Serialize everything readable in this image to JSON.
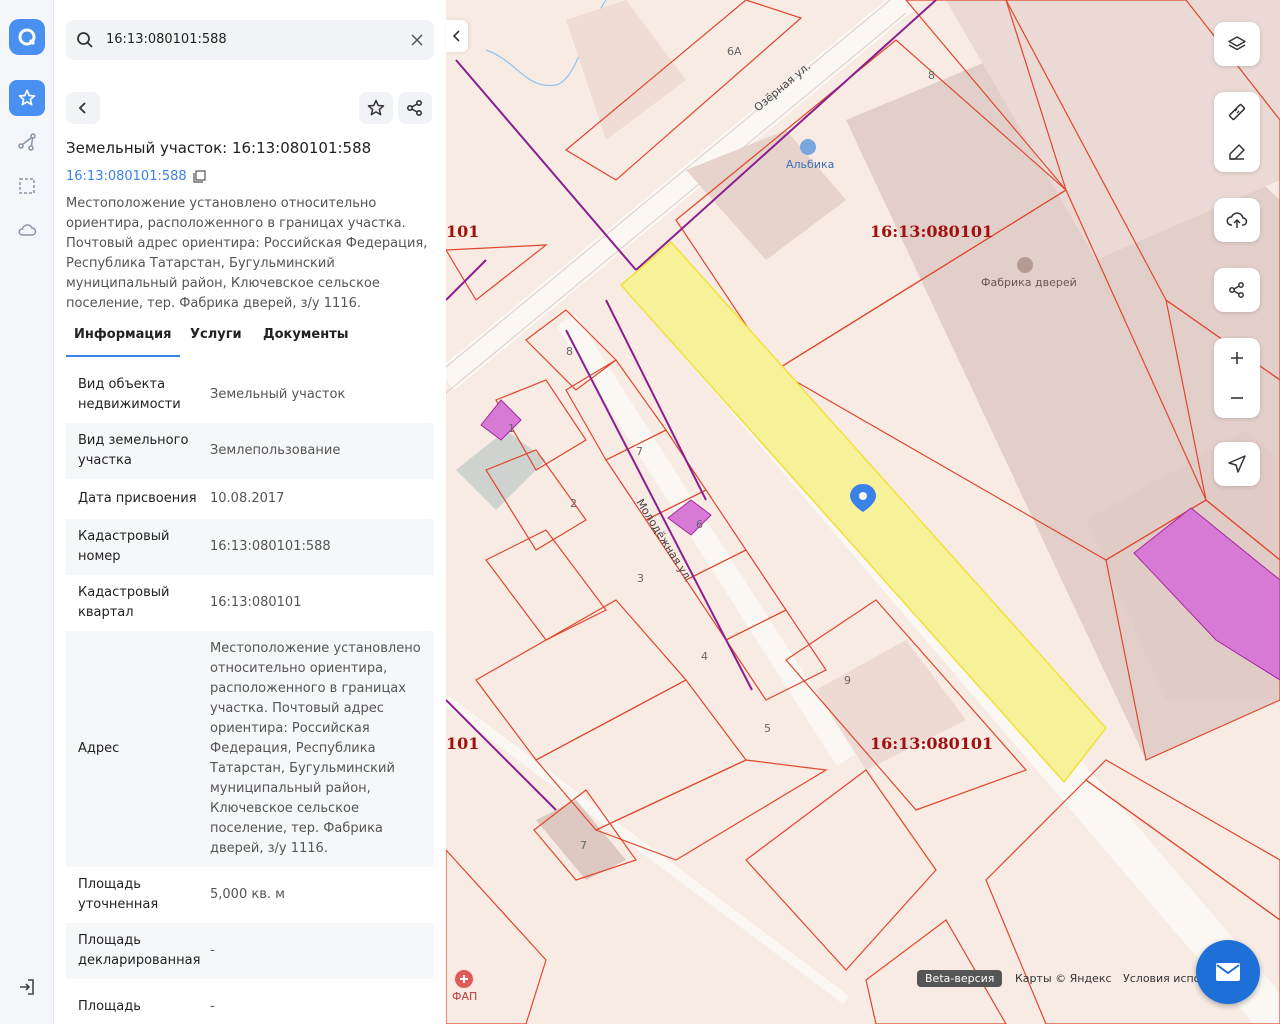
{
  "search": {
    "value": "16:13:080101:588"
  },
  "card": {
    "title": "Земельный участок: 16:13:080101:588",
    "cad_number": "16:13:080101:588",
    "description": "Местоположение установлено относительно ориентира, расположенного в границах участка. Почтовый адрес ориентира: Российская Федерация, Республика Татарстан, Бугульминский муниципальный район, Ключевское сельское поселение, тер. Фабрика дверей, з/у 1116."
  },
  "tabs": [
    {
      "label": "Информация",
      "active": true
    },
    {
      "label": "Услуги",
      "active": false
    },
    {
      "label": "Документы",
      "active": false
    }
  ],
  "info_rows": [
    {
      "key": "Вид объекта недвижимости",
      "value": "Земельный участок"
    },
    {
      "key": "Вид земельного участка",
      "value": "Землепользование"
    },
    {
      "key": "Дата присвоения",
      "value": "10.08.2017"
    },
    {
      "key": "Кадастровый номер",
      "value": "16:13:080101:588"
    },
    {
      "key": "Кадастровый квартал",
      "value": "16:13:080101"
    },
    {
      "key": "Адрес",
      "value": "Местоположение установлено относительно ориентира, расположенного в границах участка. Почтовый адрес ориентира: Российская Федерация, Республика Татарстан, Бугульминский муниципальный район, Ключевское сельское поселение, тер. Фабрика дверей, з/у 1116."
    },
    {
      "key": "Площадь уточненная",
      "value": "5,000 кв. м"
    },
    {
      "key": "Площадь декларированная",
      "value": "-"
    },
    {
      "key": "Площадь",
      "value": "-"
    }
  ],
  "map": {
    "quarter_labels": [
      "16:13:080101",
      "16:13:080101",
      "101",
      "101"
    ],
    "street_ozernaya": "Озёрная ул.",
    "street_molodezhnaya": "Молодёжная ул.",
    "poi_albika": "Альбика",
    "poi_factory": "Фабрика дверей",
    "poi_fap": "ФАП",
    "house_numbers": [
      "6А",
      "8",
      "8",
      "1",
      "7",
      "2",
      "6",
      "3",
      "4",
      "9",
      "5",
      "7"
    ]
  },
  "footer": {
    "beta": "Beta-версия",
    "maps_credit": "Карты © Яндекс",
    "terms": "Условия испол"
  },
  "colors": {
    "accent": "#4a90f0",
    "parcel_outline": "#e0472e",
    "selected_parcel": "#f7f19a",
    "quarter_border": "#8a1f8f",
    "quarter_label": "#a01010"
  }
}
